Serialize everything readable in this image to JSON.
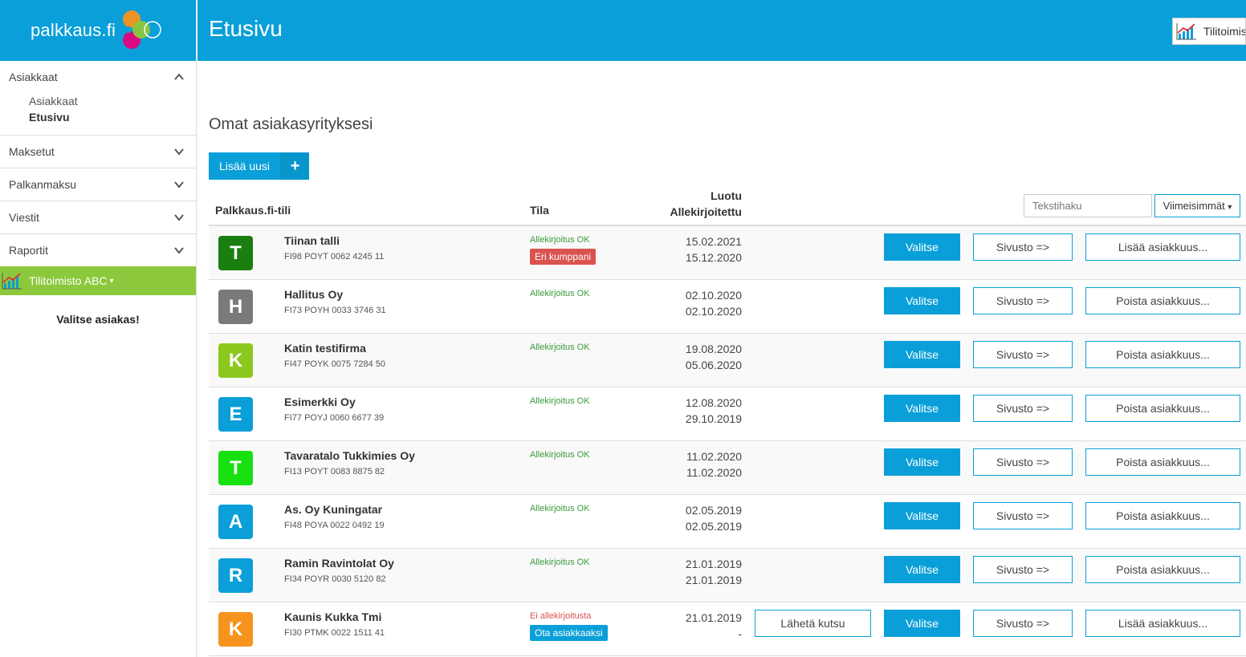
{
  "brand": {
    "logo_text": "palkkaus.fi",
    "accent": "#0a9fd8",
    "green": "#8cc83c"
  },
  "sidebar": {
    "sections": [
      {
        "label": "Asiakkaat",
        "expanded": true,
        "sub": [
          "Asiakkaat",
          "Etusivu"
        ]
      },
      {
        "label": "Maksetut"
      },
      {
        "label": "Palkanmaksu"
      },
      {
        "label": "Viestit"
      },
      {
        "label": "Raportit"
      }
    ],
    "account": "Tilitoimisto ABC",
    "account_caret": "▾",
    "prompt": "Valitse asiakas!"
  },
  "header": {
    "title": "Etusivu",
    "account_button": "Tilitoimisto ABC"
  },
  "main": {
    "section_title": "Omat asiakasyrityksesi",
    "add_button": "Lisää uusi",
    "add_plus": "+",
    "columns": {
      "account": "Palkkaus.fi-tili",
      "state": "Tila",
      "created": "Luotu",
      "signed": "Allekirjoitettu"
    },
    "search_placeholder": "Tekstihaku",
    "sort_label": "Viimeisimmät",
    "sort_caret": "▾",
    "rows": [
      {
        "initial": "T",
        "color": "#1a7f10",
        "name": "Tiinan talli",
        "iban": "FI98 POYT 0062 4245 11",
        "status": "Allekirjoitus OK",
        "status_type": "ok",
        "badge": "Eri kumppani",
        "badge_type": "red",
        "created": "15.02.2021",
        "signed": "15.12.2020",
        "invite": "",
        "select": "Valitse",
        "site": "Sivusto =>",
        "extra": "Lisää asiakkuus..."
      },
      {
        "initial": "H",
        "color": "#7a7a7a",
        "name": "Hallitus Oy",
        "iban": "FI73 POYH 0033 3746 31",
        "status": "Allekirjoitus OK",
        "status_type": "ok",
        "badge": "",
        "badge_type": "",
        "created": "02.10.2020",
        "signed": "02.10.2020",
        "invite": "",
        "select": "Valitse",
        "site": "Sivusto =>",
        "extra": "Poista asiakkuus..."
      },
      {
        "initial": "K",
        "color": "#8cc81e",
        "name": "Katin testifirma",
        "iban": "FI47 POYK 0075 7284 50",
        "status": "Allekirjoitus OK",
        "status_type": "ok",
        "badge": "",
        "badge_type": "",
        "created": "19.08.2020",
        "signed": "05.06.2020",
        "invite": "",
        "select": "Valitse",
        "site": "Sivusto =>",
        "extra": "Poista asiakkuus..."
      },
      {
        "initial": "E",
        "color": "#0a9fd8",
        "name": "Esimerkki Oy",
        "iban": "FI77 POYJ 0060 6677 39",
        "status": "Allekirjoitus OK",
        "status_type": "ok",
        "badge": "",
        "badge_type": "",
        "created": "12.08.2020",
        "signed": "29.10.2019",
        "invite": "",
        "select": "Valitse",
        "site": "Sivusto =>",
        "extra": "Poista asiakkuus..."
      },
      {
        "initial": "T",
        "color": "#18e010",
        "name": "Tavaratalo Tukkimies Oy",
        "iban": "FI13 POYT 0083 8875 82",
        "status": "Allekirjoitus OK",
        "status_type": "ok",
        "badge": "",
        "badge_type": "",
        "created": "11.02.2020",
        "signed": "11.02.2020",
        "invite": "",
        "select": "Valitse",
        "site": "Sivusto =>",
        "extra": "Poista asiakkuus..."
      },
      {
        "initial": "A",
        "color": "#0a9fd8",
        "name": "As. Oy Kuningatar",
        "iban": "FI48 POYA 0022 0492 19",
        "status": "Allekirjoitus OK",
        "status_type": "ok",
        "badge": "",
        "badge_type": "",
        "created": "02.05.2019",
        "signed": "02.05.2019",
        "invite": "",
        "select": "Valitse",
        "site": "Sivusto =>",
        "extra": "Poista asiakkuus..."
      },
      {
        "initial": "R",
        "color": "#0a9fd8",
        "name": "Ramin Ravintolat Oy",
        "iban": "FI34 POYR 0030 5120 82",
        "status": "Allekirjoitus OK",
        "status_type": "ok",
        "badge": "",
        "badge_type": "",
        "created": "21.01.2019",
        "signed": "21.01.2019",
        "invite": "",
        "select": "Valitse",
        "site": "Sivusto =>",
        "extra": "Poista asiakkuus..."
      },
      {
        "initial": "K",
        "color": "#f7941d",
        "name": "Kaunis Kukka Tmi",
        "iban": "FI30 PTMK 0022 1511 41",
        "status": "Ei allekirjoitusta",
        "status_type": "no",
        "badge": "Ota asiakkaaksi",
        "badge_type": "blue",
        "created": "21.01.2019",
        "signed": "-",
        "invite": "Lähetä kutsu",
        "select": "Valitse",
        "site": "Sivusto =>",
        "extra": "Lisää asiakkuus..."
      }
    ]
  }
}
